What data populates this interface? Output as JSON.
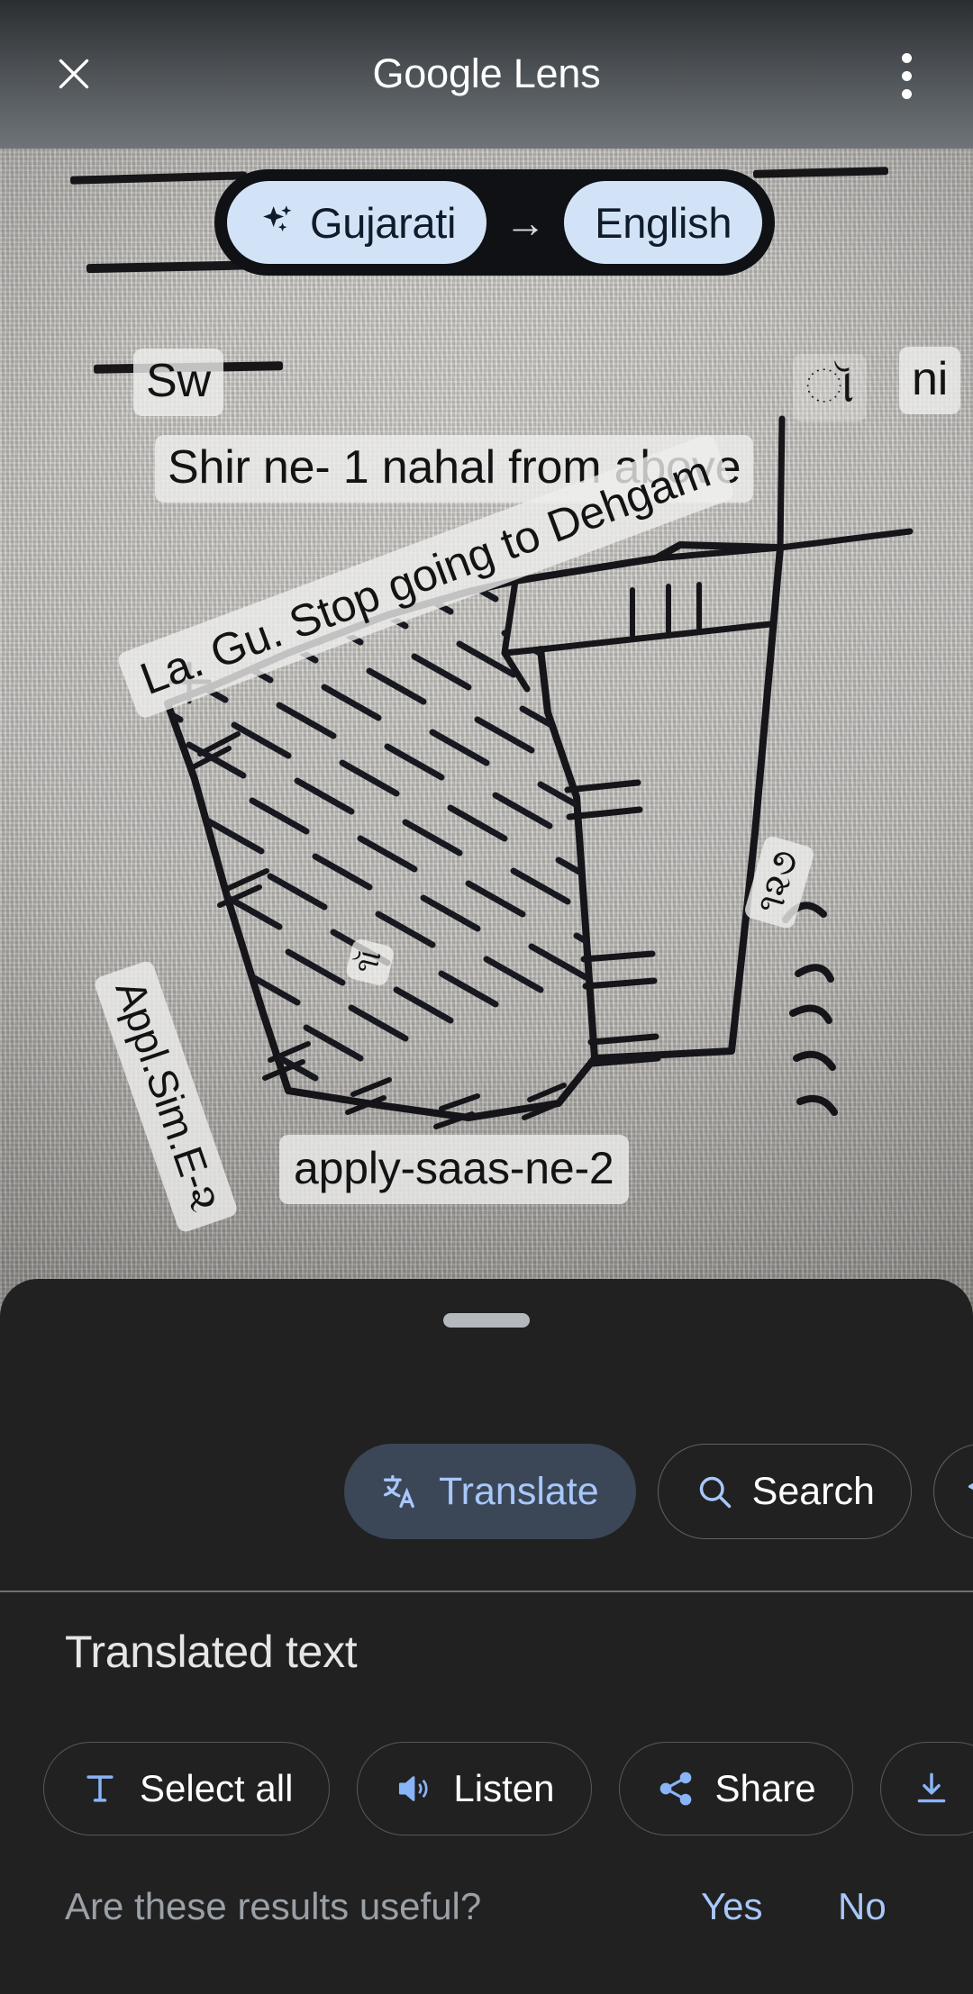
{
  "appbar": {
    "brand": "Google",
    "product": " Lens",
    "close_icon": "close-icon",
    "overflow_icon": "more-vert-icon"
  },
  "language_bar": {
    "source": "Gujarati",
    "source_icon": "sparkle-auto-detect-icon",
    "arrow": "→",
    "target": "English"
  },
  "photo_overlays": {
    "fragment_left": "Sw",
    "fragment_right": "ni",
    "fragment_gu": "ૉ",
    "line_1": "Shir ne- 1 nahal from above",
    "dehgam": "La. Gu. Stop going to Dehgam",
    "appl_sim": "Appl.Sim.E-૨",
    "apply_saas": "apply-saas-ne-2",
    "number_127": "૧૨૭",
    "tiny_mark": "૧ૉ"
  },
  "sheet": {
    "handle": "drag-handle",
    "modes": [
      {
        "label": "Translate",
        "icon": "translate-icon",
        "selected": true
      },
      {
        "label": "Search",
        "icon": "search-icon",
        "selected": false
      },
      {
        "label": "",
        "icon": "homework-graduation-cap-icon",
        "selected": false
      }
    ],
    "translated_title": "Translated text",
    "actions": [
      {
        "label": "Select all",
        "icon": "select-text-icon"
      },
      {
        "label": "Listen",
        "icon": "speaker-icon"
      },
      {
        "label": "Share",
        "icon": "share-icon"
      },
      {
        "label": "",
        "icon": "download-icon"
      }
    ],
    "feedback": {
      "question": "Are these results useful?",
      "yes": "Yes",
      "no": "No"
    }
  },
  "colors": {
    "accent_blue": "#a8c7fa",
    "pill_bg": "#d3e3f7",
    "pill_text": "#101c2b",
    "sheet_bg": "#212121",
    "chip_selected_bg": "#3b4757"
  }
}
